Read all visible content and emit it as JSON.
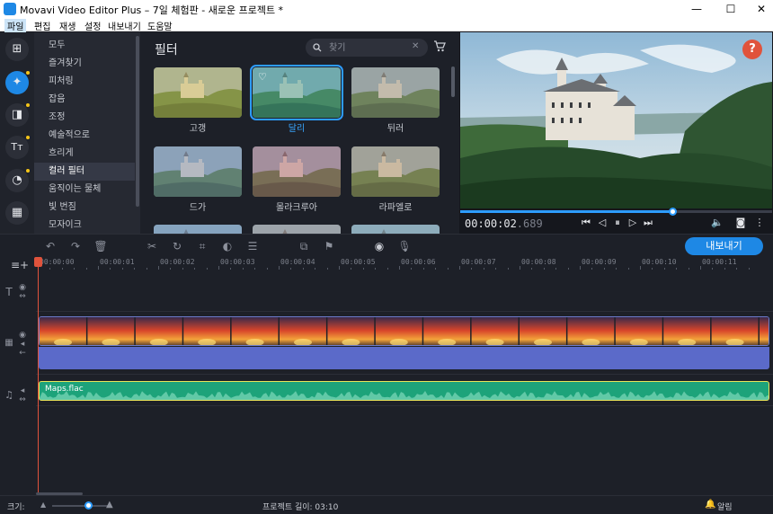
{
  "window": {
    "title": "Movavi Video Editor Plus – 7일 체험판 - 새로운 프로젝트 *",
    "minimize": "—",
    "maximize": "☐",
    "close": "✕"
  },
  "menu": [
    "파일",
    "편집",
    "재생",
    "설정",
    "내보내기",
    "도움말"
  ],
  "rail": {
    "items": [
      {
        "name": "import-icon",
        "glyph": "⊞"
      },
      {
        "name": "filters-icon",
        "glyph": "✦"
      },
      {
        "name": "transitions-icon",
        "glyph": "◨"
      },
      {
        "name": "titles-icon",
        "glyph": "Tт"
      },
      {
        "name": "stickers-icon",
        "glyph": "◔"
      },
      {
        "name": "more-tools-icon",
        "glyph": "▦"
      }
    ],
    "accent": "#1e88e5",
    "dot_color": "#f5c518"
  },
  "categories": {
    "items": [
      "모두",
      "즐겨찾기",
      "피처링",
      "잡음",
      "조정",
      "예술적으로",
      "흐리게",
      "컬러 필터",
      "움직이는 물체",
      "빛 번짐",
      "모자이크"
    ],
    "active_index": 7
  },
  "filters": {
    "title": "필터",
    "search_placeholder": "찾기",
    "items": [
      {
        "label": "고갱",
        "tint": "#c9b34a"
      },
      {
        "label": "달리",
        "tint": "#3f9c8e"
      },
      {
        "label": "뒤러",
        "tint": "#9a8f79"
      },
      {
        "label": "드가",
        "tint": "#7b8aa8"
      },
      {
        "label": "몰라크루아",
        "tint": "#b0606a"
      },
      {
        "label": "라파엘로",
        "tint": "#a88a62"
      },
      {
        "label": "",
        "tint": "#6d8fb5"
      },
      {
        "label": "",
        "tint": "#a08f88"
      },
      {
        "label": "",
        "tint": "#7c9fae"
      }
    ],
    "selected_index": 1
  },
  "preview": {
    "help": "?",
    "timecode_main": "00:00:02",
    "timecode_frames": ".689",
    "progress": 0.68,
    "accent": "#2d9cff"
  },
  "toolbar": {
    "export_label": "내보내기"
  },
  "timeline": {
    "ticks": [
      "00:00:00",
      "00:00:01",
      "00:00:02",
      "00:00:03",
      "00:00:04",
      "00:00:05",
      "00:00:06",
      "00:00:07",
      "00:00:08",
      "00:00:09",
      "00:00:10",
      "00:00:11"
    ],
    "audio_clip": "Maps.flac",
    "audio_color": "#1da37a",
    "video_under_color": "#5b6ac9"
  },
  "status": {
    "zoom_label": "크기:",
    "zoom_level": 0.65,
    "project_length": "프로젝트 길이: 03:10",
    "notifications": "알림"
  }
}
